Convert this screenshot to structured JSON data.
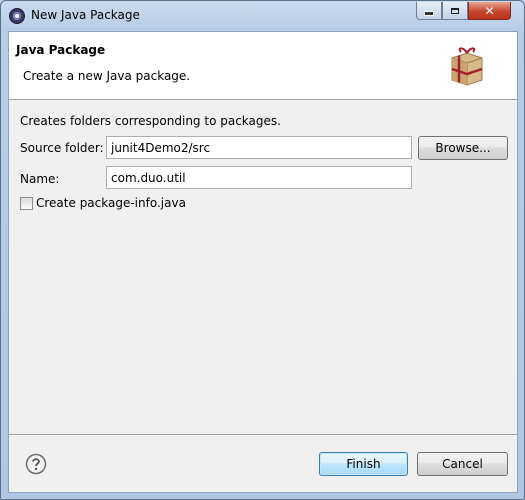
{
  "window": {
    "title": "New Java Package",
    "icon": "eclipse-icon",
    "controls": {
      "minimize": "minimize-icon",
      "maximize": "maximize-icon",
      "close": "✕"
    }
  },
  "banner": {
    "title": "Java Package",
    "description": "Create a new Java package.",
    "icon": "package-icon"
  },
  "form": {
    "intro": "Creates folders corresponding to packages.",
    "source_folder": {
      "label": "Source folder:",
      "value": "junit4Demo2/src"
    },
    "browse_label": "Browse...",
    "name": {
      "label": "Name:",
      "value": "com.duo.util"
    },
    "package_info": {
      "label": "Create package-info.java",
      "checked": false
    }
  },
  "footer": {
    "help_icon": "help-icon",
    "finish_label": "Finish",
    "cancel_label": "Cancel"
  },
  "colors": {
    "title_bar": "#b9d1ea",
    "dialog_bg": "#f0f0f0",
    "close_button": "#c7482f",
    "default_button_border": "#3c7fb1"
  }
}
